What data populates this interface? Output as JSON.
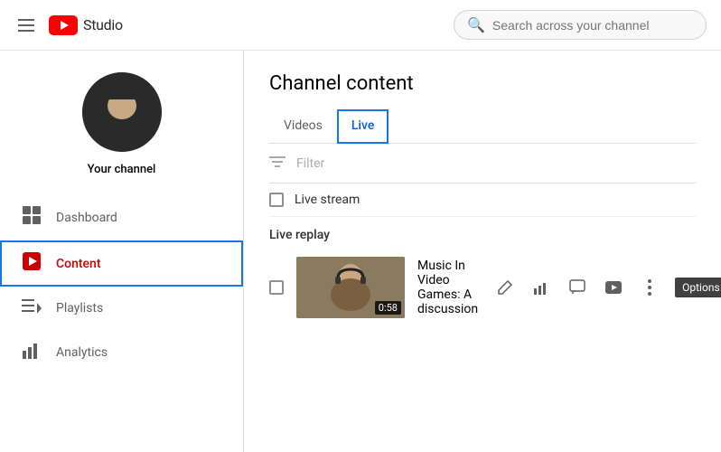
{
  "header": {
    "menu_label": "Menu",
    "logo_text": "Studio",
    "search_placeholder": "Search across your channel"
  },
  "sidebar": {
    "channel_label": "Your channel",
    "nav_items": [
      {
        "id": "dashboard",
        "label": "Dashboard",
        "icon": "⊞"
      },
      {
        "id": "content",
        "label": "Content",
        "icon": "▶",
        "active": true
      },
      {
        "id": "playlists",
        "label": "Playlists",
        "icon": "☰"
      },
      {
        "id": "analytics",
        "label": "Analytics",
        "icon": "📊"
      }
    ]
  },
  "main": {
    "page_title": "Channel content",
    "tabs": [
      {
        "id": "videos",
        "label": "Videos",
        "active": false
      },
      {
        "id": "live",
        "label": "Live",
        "active": true
      }
    ],
    "filter_label": "Filter",
    "live_stream_label": "Live stream",
    "live_replay_label": "Live replay",
    "video": {
      "title": "Music In Video Games: A discussion",
      "duration": "0:58"
    },
    "options_label": "Options"
  }
}
